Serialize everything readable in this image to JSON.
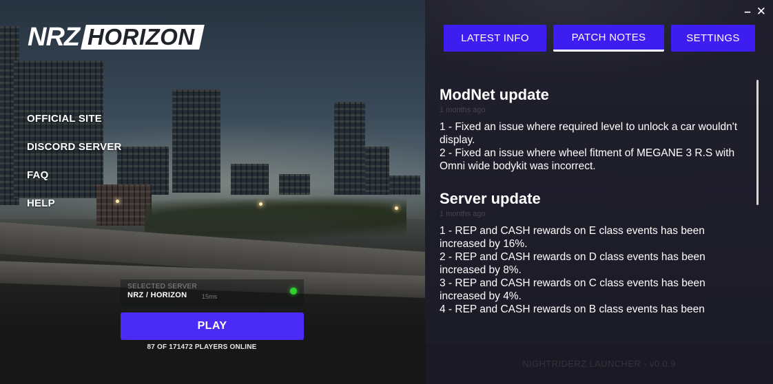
{
  "logo": {
    "part1": "NRZ",
    "part2": "HORIZON"
  },
  "side_nav": [
    "OFFICIAL SITE",
    "DISCORD SERVER",
    "FAQ",
    "HELP"
  ],
  "server": {
    "caption": "SELECTED SERVER",
    "name": "NRZ / HORIZON",
    "ping": "15ms",
    "status_color": "#2fd12f"
  },
  "play_label": "PLAY",
  "players_online": "87 OF 171472 PLAYERS ONLINE",
  "window_controls": {
    "minimize": "–",
    "close": "✕"
  },
  "tabs": [
    {
      "label": "LATEST INFO",
      "active": false
    },
    {
      "label": "PATCH NOTES",
      "active": true
    },
    {
      "label": "SETTINGS",
      "active": false
    }
  ],
  "notes": [
    {
      "title": "ModNet update",
      "time": "1 months ago",
      "lines": [
        "1 - Fixed an issue where required level to unlock a car wouldn't display.",
        "2 - Fixed an issue where wheel fitment of MEGANE 3 R.S with Omni wide bodykit was incorrect."
      ]
    },
    {
      "title": "Server update",
      "time": "1 months ago",
      "lines": [
        "1 - REP and CASH rewards on E class events has been increased by 16%.",
        "2 - REP and CASH rewards on D class events has been increased by 8%.",
        "3 - REP and CASH rewards on C class events has been increased by 4%.",
        "4 - REP and CASH rewards on B class events has been"
      ]
    }
  ],
  "footer": "NIGHTRIDERZ LAUNCHER - v0.0.9",
  "colors": {
    "accent": "#3d1df0",
    "play": "#4a2cf5",
    "panel_bg": "#1d1c29"
  }
}
